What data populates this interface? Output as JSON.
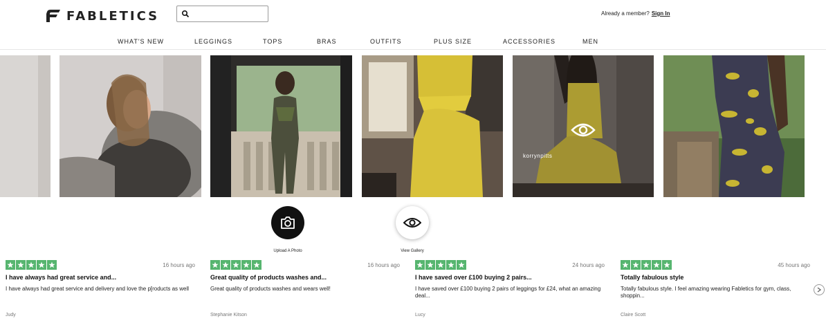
{
  "header": {
    "logo_text": "FABLETICS",
    "search": {
      "value": "",
      "placeholder": ""
    },
    "member_prompt": "Already a member?",
    "sign_in_label": "Sign In"
  },
  "nav": {
    "items": [
      {
        "label": "WHAT'S NEW"
      },
      {
        "label": "LEGGINGS"
      },
      {
        "label": "TOPS"
      },
      {
        "label": "BRAS"
      },
      {
        "label": "OUTFITS"
      },
      {
        "label": "PLUS SIZE"
      },
      {
        "label": "ACCESSORIES"
      },
      {
        "label": "MEN"
      }
    ]
  },
  "gallery": {
    "hovered_username": "korrynpitts"
  },
  "actions": {
    "upload_label": "Upload A Photo",
    "view_gallery_label": "View Gallery"
  },
  "reviews": [
    {
      "stars": 5,
      "time": "16 hours ago",
      "title": "I have always had great service and...",
      "body": "I have always had great service and delivery and love the p[roducts as well",
      "author": "Judy"
    },
    {
      "stars": 5,
      "time": "16 hours ago",
      "title": "Great quality of products washes and...",
      "body": "Great quality of products washes and wears well!",
      "author": "Stephanie Kitson"
    },
    {
      "stars": 5,
      "time": "24 hours ago",
      "title": "I have saved over £100 buying 2 pairs...",
      "body": "I have saved over £100 buying 2 pairs of leggings for £24, what an amazing deal...",
      "author": "Lucy"
    },
    {
      "stars": 5,
      "time": "45 hours ago",
      "title": "Totally fabulous style",
      "body": "Totally fabulous style. I feel amazing wearing Fabletics for gym, class, shoppin...",
      "author": "Claire Scott"
    }
  ],
  "colors": {
    "star_green": "#56b56f",
    "brand_dark": "#111111"
  }
}
